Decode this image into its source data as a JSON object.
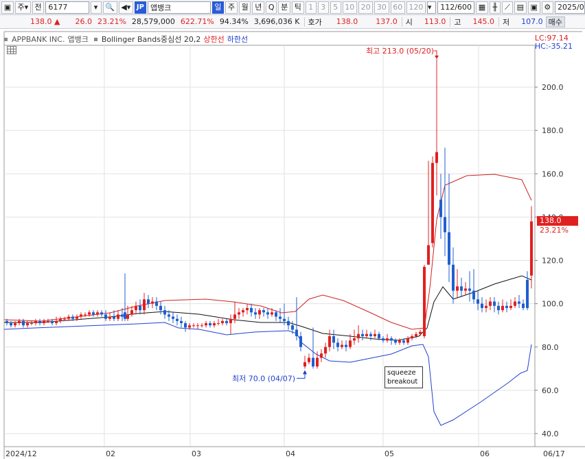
{
  "toolbar": {
    "mode_label": "주",
    "type_label": "전",
    "code_value": "6177",
    "market_badge": "JP",
    "stock_name": "앱뱅크",
    "period_buttons": [
      "일",
      "주",
      "월",
      "년",
      "Q",
      "분",
      "틱"
    ],
    "active_period": "일",
    "interval_buttons": [
      "1",
      "3",
      "5",
      "10",
      "20",
      "30",
      "60",
      "120"
    ],
    "count_value": "112",
    "count_total": "/600",
    "date_value": "2025/0"
  },
  "price": {
    "current": "138.0",
    "change": "26.0",
    "change_pct": "23.21%",
    "volume": "28,579,000",
    "volume_pct": "622.71%",
    "ratio": "94.34%",
    "amount": "3,696,036 K",
    "quote_label": "호가",
    "ask": "138.0",
    "bid": "137.0",
    "open_label": "시",
    "open": "113.0",
    "high_label": "고",
    "high": "145.0",
    "low_label": "저",
    "low": "107.0",
    "side_tab": "매수"
  },
  "legend": {
    "company": "APPBANK INC.",
    "company_kr": "앱뱅크",
    "indicator": "Bollinger Bands중심선 20,2",
    "upper": "상한선",
    "lower": "하한선"
  },
  "lc_hc": {
    "lc": "LC:97.14",
    "hc": "HC:-35.21"
  },
  "price_tag": {
    "value": "138.0",
    "pct": "23.21%"
  },
  "annotations": {
    "high": "최고 213.0 (05/20)",
    "low": "최저 70.0 (04/07)",
    "box_line1": "squeeze",
    "box_line2": "breakout"
  },
  "chart_data": {
    "type": "candlestick",
    "ylim": [
      38,
      222
    ],
    "yticks": [
      "200.0",
      "180.0",
      "160.0",
      "140.0",
      "120.0",
      "100.0",
      "80.0",
      "60.0",
      "40.0"
    ],
    "xlabels": [
      "2024/12",
      "02",
      "03",
      "04",
      "05",
      "06",
      "06/17"
    ],
    "series": [
      {
        "name": "상한선",
        "color": "#d02020"
      },
      {
        "name": "중심선",
        "color": "#111111"
      },
      {
        "name": "하한선",
        "color": "#1f3fd0"
      }
    ],
    "high": {
      "value": 213.0,
      "date": "05/20"
    },
    "low": {
      "value": 70.0,
      "date": "04/07"
    },
    "last": 138.0
  }
}
